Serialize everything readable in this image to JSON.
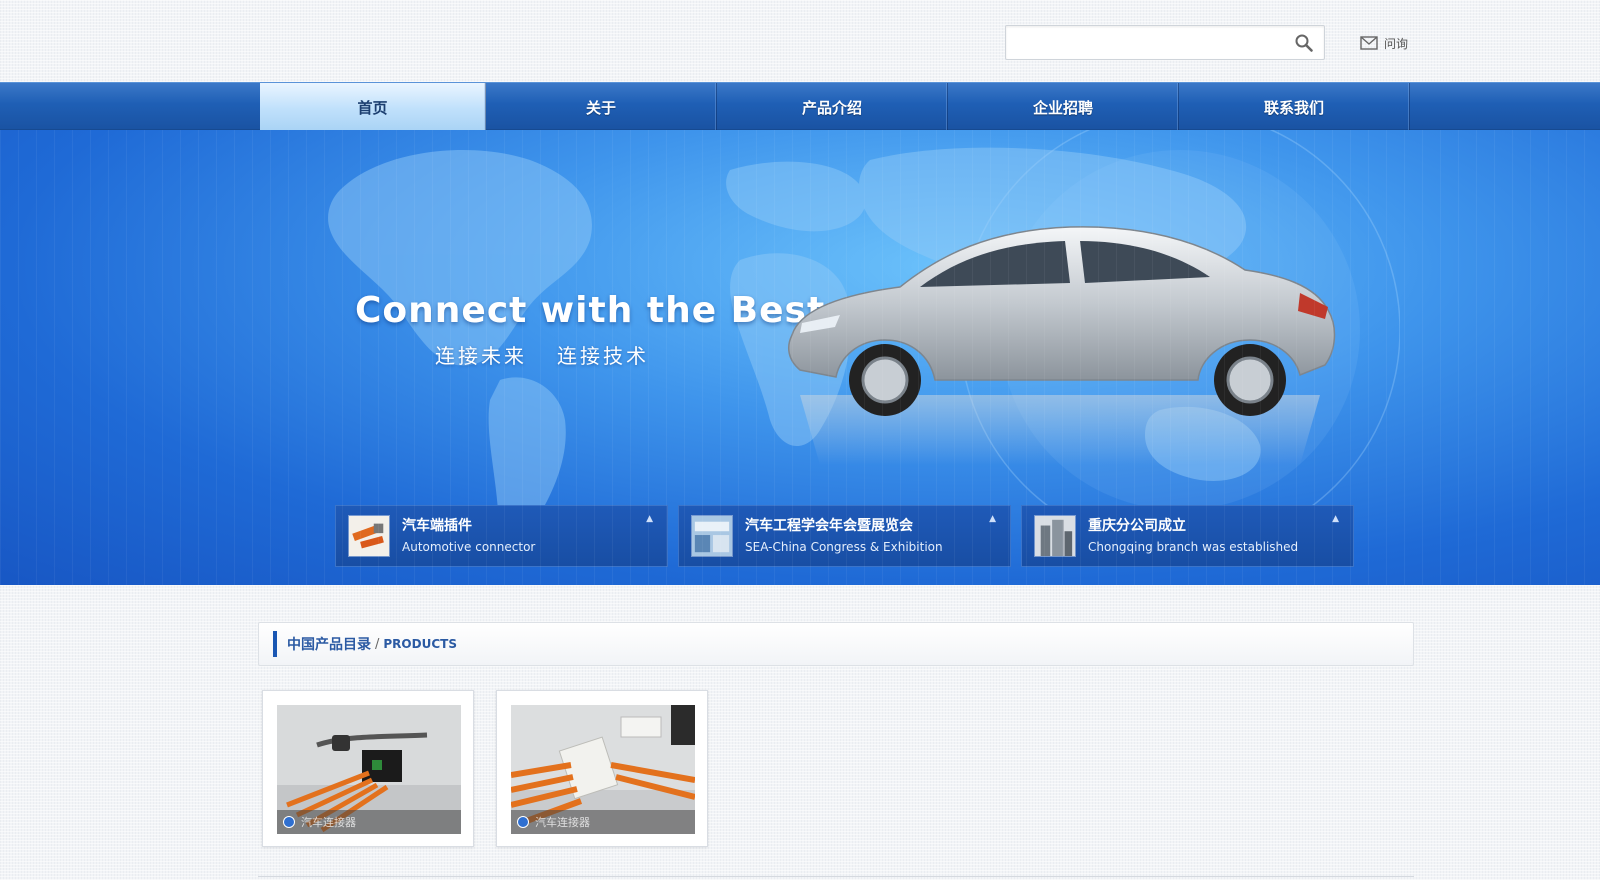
{
  "search": {
    "placeholder": "",
    "value": ""
  },
  "header": {
    "message_label": "问询"
  },
  "nav": {
    "items": [
      {
        "label": "首页",
        "active": true
      },
      {
        "label": "关于"
      },
      {
        "label": "产品介绍"
      },
      {
        "label": "企业招聘"
      },
      {
        "label": "联系我们"
      }
    ]
  },
  "banner": {
    "headline": "Connect with the Best",
    "sub1": "连接未来",
    "sub2": "连接技术"
  },
  "news": [
    {
      "title": "汽车端插件",
      "subtitle": "Automotive connector"
    },
    {
      "title": "汽车工程学会年会暨展览会",
      "subtitle": "SEA-China Congress & Exhibition"
    },
    {
      "title": "重庆分公司成立",
      "subtitle": "Chongqing branch was established"
    }
  ],
  "products_section": {
    "title": "中国产品目录",
    "separator": "/",
    "title_en": "PRODUCTS"
  },
  "products": [
    {
      "caption": "汽车连接器"
    },
    {
      "caption": "汽车连接器"
    }
  ],
  "colors": {
    "nav_blue": "#1f5fb5",
    "accent_blue": "#1a57b3",
    "banner_blue": "#3f95ec"
  }
}
